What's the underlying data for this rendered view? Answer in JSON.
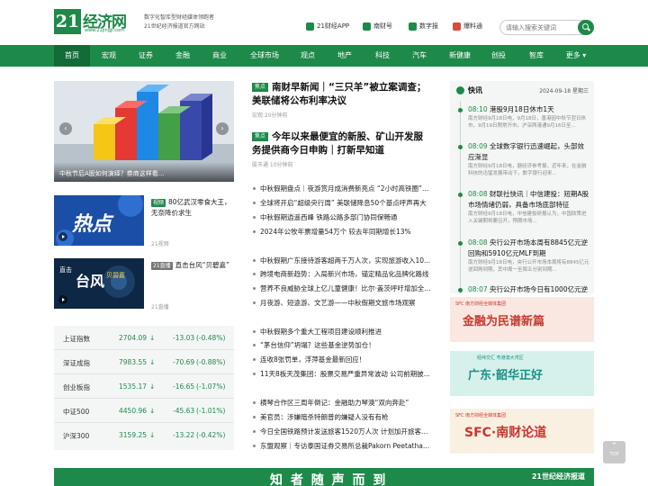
{
  "header": {
    "logo_num": "21",
    "logo_name": "经济网",
    "logo_url": "www.21jingji.com",
    "slogan_line1": "数字化智库型财经媒体领跑者",
    "slogan_line2": "21世纪经济报道官方网站",
    "links": [
      {
        "label": "21财经APP",
        "icon": "mobile-app-icon"
      },
      {
        "label": "南财号",
        "icon": "nancai-icon"
      },
      {
        "label": "数字报",
        "icon": "newspaper-icon"
      },
      {
        "label": "爆料通",
        "icon": "report-icon"
      }
    ],
    "search_placeholder": "请输入搜索关键词"
  },
  "nav": [
    "首页",
    "宏观",
    "证券",
    "金融",
    "商业",
    "全球市场",
    "观点",
    "地产",
    "科技",
    "汽车",
    "新健康",
    "创投",
    "智库",
    "更多"
  ],
  "carousel": {
    "caption": "中秋节后A股如何演绎？券商这样看..."
  },
  "side_items": [
    {
      "badge": "视频",
      "title": "80亿武汉零食大王，无奈降价求生",
      "meta": "21视频"
    },
    {
      "badge": "21直播",
      "title": "直击台风“贝碧嘉”",
      "meta": "21直播"
    }
  ],
  "thumb_text": {
    "hot": "热点",
    "typhoon": "台风",
    "typhoon_top": "直击",
    "typhoon_sub": "贝碧嘉"
  },
  "stocks": [
    {
      "name": "上证指数",
      "value": "2704.09",
      "change": "-13.03",
      "pct": "(-0.48%)"
    },
    {
      "name": "深证成指",
      "value": "7983.55",
      "change": "-70.69",
      "pct": "(-0.88%)"
    },
    {
      "name": "创业板指",
      "value": "1535.17",
      "change": "-16.65",
      "pct": "(-1.07%)"
    },
    {
      "name": "中证500",
      "value": "4450.96",
      "change": "-45.63",
      "pct": "(-1.01%)"
    },
    {
      "name": "沪深300",
      "value": "3159.25",
      "change": "-13.22",
      "pct": "(-0.42%)"
    }
  ],
  "headlines": [
    {
      "badge": "焦点",
      "title": "南财早新闻｜“三只羊”被立案调查；美联储将公布利率决议",
      "meta": "宏观 20分钟前"
    },
    {
      "badge": "焦点",
      "title": "今年以来最便宜的新股、矿山开发服务提供商今日申购｜打新早知道",
      "meta": "股市通 10分钟前"
    }
  ],
  "news_group1": [
    "中秋假期盘点｜夜游赏月成消费新亮点 “2小时高铁圈”人...",
    "全球将开启“超级央行周” 美联储降息50个基点呼声再大",
    "中秋假期逍遥西峰 铁路公路多部门协同保畅通",
    "2024年公牧年票增量54万个 较去年同期增长13%"
  ],
  "news_group2": [
    "中秋假期广东接待游客超两千万人次，实现旅游收入10...",
    "跨境电商新趋势：入局新兴市场，锚定精品化品牌化路线",
    "营养不良威胁全球上亿儿童健康！比尔·盖茨呼吁增加全...",
    "月夜游、短途游、文艺游——中秋假期文旅市场观察"
  ],
  "news_group3": [
    "中秋假期多个重大工程项目建设顺利推进",
    "“茅台信仰”坍塌？这些基金逆势加仓！",
    "连收8张罚单，浮萍基金最新回应！",
    "11天8板天茂集团：股票交易严重异常波动 公司前期披..."
  ],
  "news_group4": [
    "横琴合作区三周年倒记：金融助力琴澳“双向奔赴”",
    "美官员：涉嫌暗杀特朗普的嫌疑人没有有枪",
    "今日全国铁路预计发送旅客1520万人次 计划加开旅客列...",
    "东盟观察｜专访泰国证券交易所总裁Pakorn Peetathaw..."
  ],
  "flash": {
    "title": "快讯",
    "date": "2024-09-18 星期三",
    "items": [
      {
        "time": "08:10",
        "title": "港股9月18日休市1天",
        "body": "南方财经9月18日电，9月18日，香港因中秋节翌日休市，9月19日照常开市。沪深两港通9月16日至..."
      },
      {
        "time": "08:09",
        "title": "全球数字银行迅速崛起，头部效应渐显",
        "body": "南方财经9月18日电，据经济参考报，近年来，在金融科技的迅猛发展带动下，数字银行迎来..."
      },
      {
        "time": "08:08",
        "title": "财联社快讯｜中信建投：短期A股市场情绪仍弱，具备市场底部特征",
        "body": "南方财经9月18日电，中信建投研报认为，中国政策进入关键期将要召开，预期市场..."
      },
      {
        "time": "08:08",
        "title": "央行公开市场本周有8845亿元逆回购和5910亿元MLF到期",
        "body": "南方财经9月18日电，央行公开市场本周将有8845亿元逆回购到期，其中周一至周五分别到期..."
      },
      {
        "time": "08:07",
        "title": "央行公开市场今日有1000亿元逆回购到期",
        "body": ""
      }
    ]
  },
  "banners": [
    {
      "text": "金融为民谱新篇",
      "top": "SFC 南方财经全媒体集团",
      "bg": "#fbe7e2",
      "fg": "#c63a2e"
    },
    {
      "text": "广东·韶华正好",
      "top": "经纬交汇 粤港澳大湾区",
      "bg": "#d6f1ec",
      "fg": "#1c8f86"
    },
    {
      "text": "SFC·南财论道",
      "top": "SFC 南方财经全媒体集团",
      "bg": "#faf0e2",
      "fg": "#c8352d"
    }
  ],
  "bottom_ad": {
    "left_text": "知 者 随 声 而 到",
    "right_text": "21世纪经济报道"
  },
  "top_button": "TOP",
  "colors": {
    "brand": "#1d8a4a",
    "nav_active": "#136c37",
    "down": "#1d8a4a"
  }
}
